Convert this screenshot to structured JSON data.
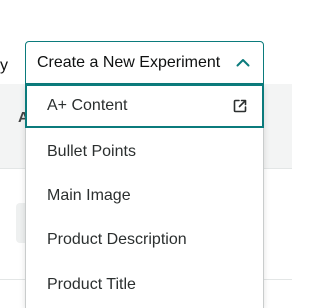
{
  "background": {
    "left_label": "y",
    "column_letter": "A"
  },
  "dropdown": {
    "selected_label": "Create a New Experiment",
    "chevron_icon": "chevron-up-icon",
    "accent_color": "#0b7b7c",
    "items": [
      {
        "label": "A+ Content",
        "icon": "external-link-icon",
        "active": true
      },
      {
        "label": "Bullet Points"
      },
      {
        "label": "Main Image"
      },
      {
        "label": "Product Description"
      },
      {
        "label": "Product Title"
      }
    ]
  }
}
